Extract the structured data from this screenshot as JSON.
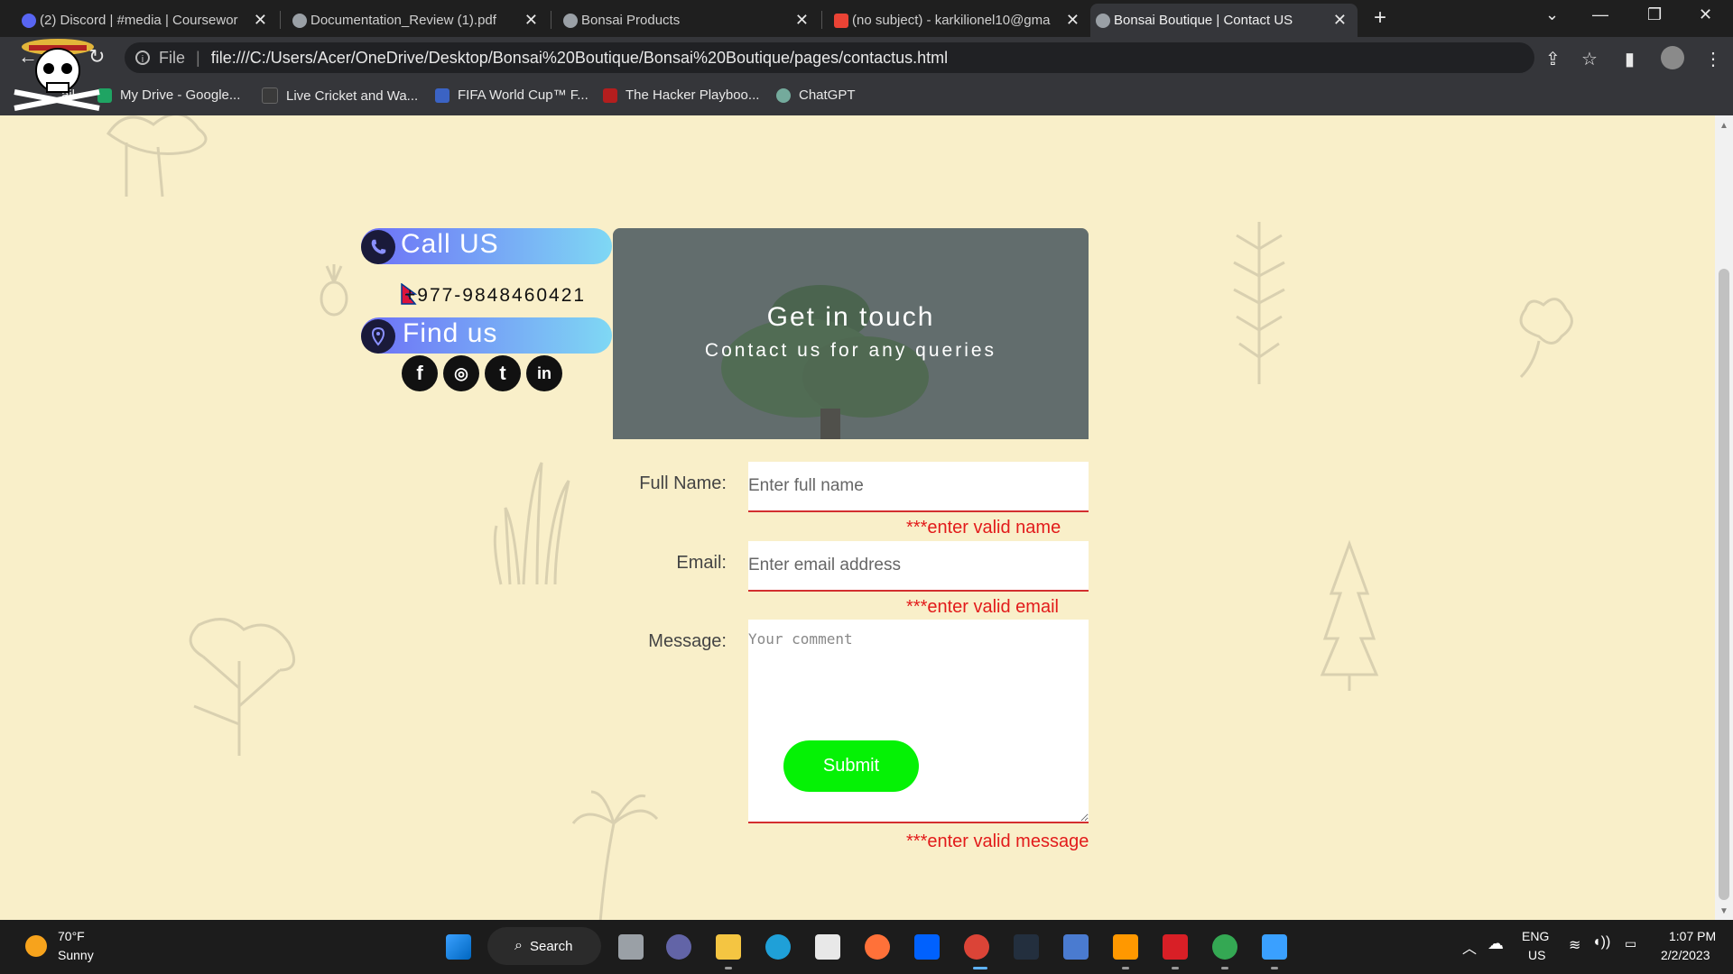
{
  "browser": {
    "tabs": [
      {
        "title": "(2) Discord | #media | Coursewor",
        "active": false
      },
      {
        "title": "Documentation_Review (1).pdf",
        "active": false
      },
      {
        "title": "Bonsai Products",
        "active": false
      },
      {
        "title": "(no subject) - karkilionel10@gma",
        "active": false
      },
      {
        "title": "Bonsai Boutique | Contact US",
        "active": true
      }
    ],
    "address": {
      "scheme_label": "File",
      "url": "file:///C:/Users/Acer/OneDrive/Desktop/Bonsai%20Boutique/Bonsai%20Boutique/pages/contactus.html"
    },
    "bookmarks": [
      "ail",
      "My Drive - Google...",
      "Live Cricket and Wa...",
      "FIFA World Cup™ F...",
      "The Hacker Playboo...",
      "ChatGPT"
    ]
  },
  "contact": {
    "call_title": "Call US",
    "phone": "+977-9848460421",
    "find_title": "Find us",
    "social": [
      "f",
      "◎",
      "t",
      "in"
    ]
  },
  "hero": {
    "title": "Get in touch",
    "subtitle": "Contact us for any queries"
  },
  "form": {
    "name_label": "Full Name:",
    "name_placeholder": "Enter full name",
    "name_error": "***enter valid name",
    "email_label": "Email:",
    "email_placeholder": "Enter email address",
    "email_error": "***enter valid email",
    "message_label": "Message:",
    "message_placeholder": "Your comment",
    "message_error": "***enter valid message",
    "submit_label": "Submit"
  },
  "taskbar": {
    "weather_temp": "70°F",
    "weather_desc": "Sunny",
    "search_label": "Search",
    "lang_top": "ENG",
    "lang_bottom": "US",
    "time": "1:07 PM",
    "date": "2/2/2023"
  },
  "colors": {
    "page_bg": "#f9efc9",
    "error": "#e21b1b",
    "submit": "#05f205"
  }
}
